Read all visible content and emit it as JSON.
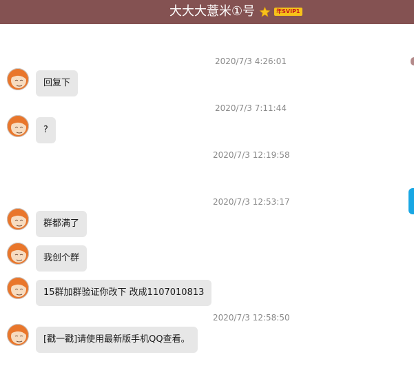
{
  "header": {
    "title": "大大大薏米①号",
    "star_icon": "star-icon",
    "vip_badge": "年SVIP1",
    "background_color": "#845252"
  },
  "messages": [
    {
      "timestamp": "2020/7/3 4:26:01",
      "text": "回复下"
    },
    {
      "timestamp": "2020/7/3 7:11:44",
      "text": "?"
    },
    {
      "timestamp": "2020/7/3 12:19:58"
    },
    {
      "timestamp": "2020/7/3 12:53:17",
      "text": "群都满了"
    },
    {
      "text": "我创个群"
    },
    {
      "text": "15群加群验证你改下 改成1107010813"
    },
    {
      "timestamp": "2020/7/3 12:58:50",
      "text": "[戳一戳]请使用最新版手机QQ查看。"
    }
  ],
  "colors": {
    "bubble": "#e7e7e7",
    "timestamp": "#8a8a8a",
    "accent": "#18a7e4"
  }
}
